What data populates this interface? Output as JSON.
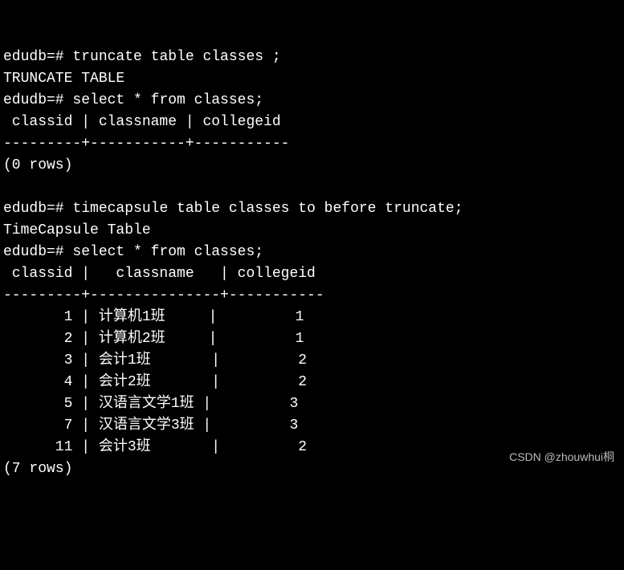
{
  "lines": {
    "l1_prompt": "edudb=# ",
    "l1_cmd": "truncate table classes ;",
    "l2": "TRUNCATE TABLE",
    "l3_prompt": "edudb=# ",
    "l3_cmd": "select * from classes;",
    "l4": " classid | classname | collegeid",
    "l5": "---------+-----------+-----------",
    "l6": "(0 rows)",
    "l7": "",
    "l8_prompt": "edudb=# ",
    "l8_cmd": "timecapsule table classes to before truncate;",
    "l9": "TimeCapsule Table",
    "l10_prompt": "edudb=# ",
    "l10_cmd": "select * from classes;",
    "l11": " classid |   classname   | collegeid",
    "l12": "---------+---------------+-----------"
  },
  "rows": [
    {
      "classid": "       1",
      "classname": " 计算机1班     ",
      "collegeid": "         1"
    },
    {
      "classid": "       2",
      "classname": " 计算机2班     ",
      "collegeid": "         1"
    },
    {
      "classid": "       3",
      "classname": " 会计1班       ",
      "collegeid": "         2"
    },
    {
      "classid": "       4",
      "classname": " 会计2班       ",
      "collegeid": "         2"
    },
    {
      "classid": "       5",
      "classname": " 汉语言文学1班 ",
      "collegeid": "         3"
    },
    {
      "classid": "       7",
      "classname": " 汉语言文学3班 ",
      "collegeid": "         3"
    },
    {
      "classid": "      11",
      "classname": " 会计3班       ",
      "collegeid": "         2"
    }
  ],
  "footer": "(7 rows)",
  "watermark": "CSDN @zhouwhui桐",
  "chart_data": {
    "type": "table",
    "title": "classes",
    "columns": [
      "classid",
      "classname",
      "collegeid"
    ],
    "data": [
      [
        1,
        "计算机1班",
        1
      ],
      [
        2,
        "计算机2班",
        1
      ],
      [
        3,
        "会计1班",
        2
      ],
      [
        4,
        "会计2班",
        2
      ],
      [
        5,
        "汉语言文学1班",
        3
      ],
      [
        7,
        "汉语言文学3班",
        3
      ],
      [
        11,
        "会计3班",
        2
      ]
    ]
  }
}
